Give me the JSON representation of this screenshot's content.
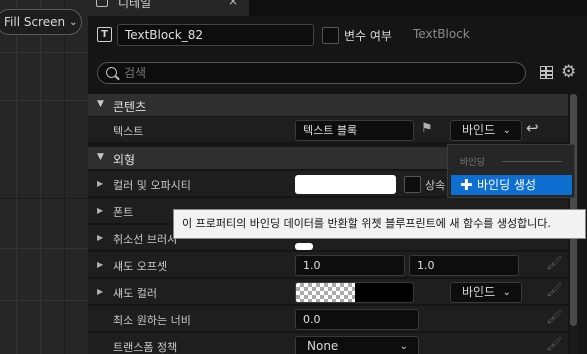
{
  "viewport": {
    "fullscreen_label": "Fill Screen"
  },
  "tab": {
    "title": "디테일",
    "close": "×"
  },
  "header": {
    "widget_name": "TextBlock_82",
    "is_variable_label": "변수 여부",
    "class_name": "TextBlock"
  },
  "search": {
    "placeholder": "검색"
  },
  "sections": {
    "content": "콘텐츠",
    "appearance": "외형"
  },
  "properties": {
    "text": {
      "label": "텍스트",
      "value": "텍스트 블록",
      "bind_label": "바인드"
    },
    "color_opacity": {
      "label": "컬러 및 오파시티",
      "inherit_label": "상속"
    },
    "font": {
      "label": "폰트"
    },
    "strikethrough": {
      "label": "취소선 브러시"
    },
    "shadow_offset": {
      "label": "섀도 오프셋",
      "x": "1.0",
      "y": "1.0"
    },
    "shadow_color": {
      "label": "섀도 컬러",
      "bind_label": "바인드"
    },
    "min_desired_width": {
      "label": "최소 원하는 너비",
      "value": "0.0"
    },
    "transform_policy": {
      "label": "트랜스폼 정책",
      "value": "None"
    }
  },
  "bind_menu": {
    "header": "바인딩",
    "create_label": "바인딩 생성"
  },
  "tooltip": {
    "text": "이 프로퍼티의 바인딩 데이터를 반환할 위젯 블루프린트에 새 함수를 생성합니다."
  },
  "icons": {
    "type_icon": "T",
    "expander_open": "▼",
    "expander_closed": "▶",
    "chevron": "⌄",
    "flag": "⚑",
    "reset": "↩",
    "plus": "✚",
    "gear": "⚙",
    "paint": "🖌"
  },
  "colors": {
    "accent": "#0e6fd0",
    "panel_bg": "#151515",
    "row_bg": "#1e1e1e",
    "section_bg": "#2f2f2f"
  }
}
